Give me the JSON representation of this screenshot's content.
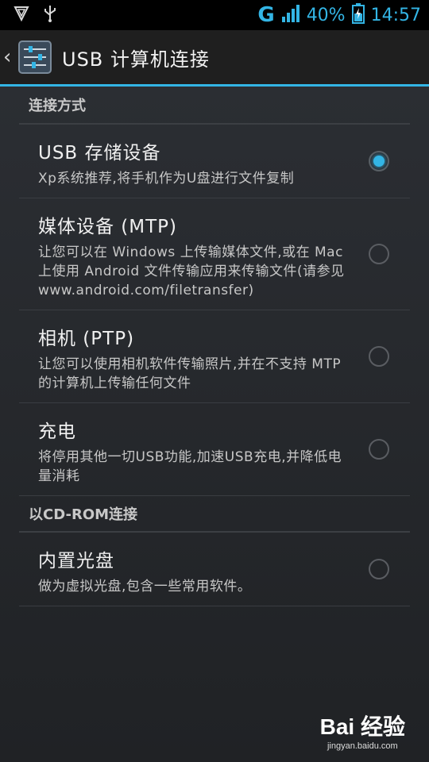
{
  "status_bar": {
    "network_type": "G",
    "battery_percent": "40%",
    "time": "14:57",
    "icons": [
      "shield-icon",
      "usb-icon",
      "signal-icon",
      "battery-icon"
    ],
    "accent_color": "#33b5e5"
  },
  "action_bar": {
    "title": "USB 计算机连接",
    "icon": "settings-sliders-icon",
    "up_icon": "chevron-left-icon"
  },
  "sections": {
    "connect_as": {
      "header": "连接方式",
      "items": [
        {
          "title": "USB 存储设备",
          "summary": "Xp系统推荐,将手机作为U盘进行文件复制",
          "checked": true
        },
        {
          "title": "媒体设备 (MTP)",
          "summary": "让您可以在 Windows 上传输媒体文件,或在 Mac 上使用 Android 文件传输应用来传输文件(请参见 www.android.com/filetransfer)",
          "checked": false
        },
        {
          "title": "相机 (PTP)",
          "summary": "让您可以使用相机软件传输照片,并在不支持 MTP 的计算机上传输任何文件",
          "checked": false
        },
        {
          "title": "充电",
          "summary": "将停用其他一切USB功能,加速USB充电,并降低电量消耗",
          "checked": false
        }
      ]
    },
    "cdrom": {
      "header": "以CD-ROM连接",
      "items": [
        {
          "title": "内置光盘",
          "summary": "做为虚拟光盘,包含一些常用软件。",
          "checked": false
        }
      ]
    }
  },
  "watermark": {
    "brand": "Bai 经验",
    "url": "jingyan.baidu.com"
  }
}
